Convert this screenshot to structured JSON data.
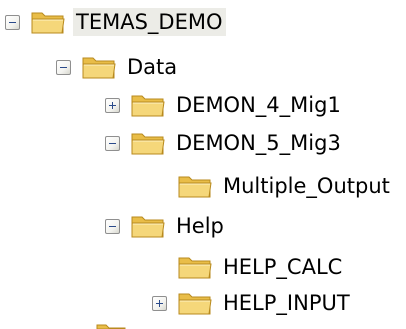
{
  "tree": {
    "nodes": [
      {
        "label": "TEMAS_DEMO",
        "expander": "minus",
        "selected": true
      },
      {
        "label": "Data",
        "expander": "minus",
        "selected": false
      },
      {
        "label": "DEMON_4_Mig1",
        "expander": "plus",
        "selected": false
      },
      {
        "label": "DEMON_5_Mig3",
        "expander": "minus",
        "selected": false
      },
      {
        "label": "Multiple_Output",
        "expander": "none",
        "selected": false
      },
      {
        "label": "Help",
        "expander": "minus",
        "selected": false
      },
      {
        "label": "HELP_CALC",
        "expander": "none",
        "selected": false
      },
      {
        "label": "HELP_INPUT",
        "expander": "plus",
        "selected": false
      }
    ]
  },
  "icons": {
    "folder": "folder-icon",
    "expand": "plus-icon",
    "collapse": "minus-icon"
  },
  "colors": {
    "folder_front": "#f5d77a",
    "folder_back": "#e9bd48",
    "folder_edge": "#b88a1e",
    "selection_bg": "#ecece7",
    "expander_border": "#8f8f8f"
  }
}
